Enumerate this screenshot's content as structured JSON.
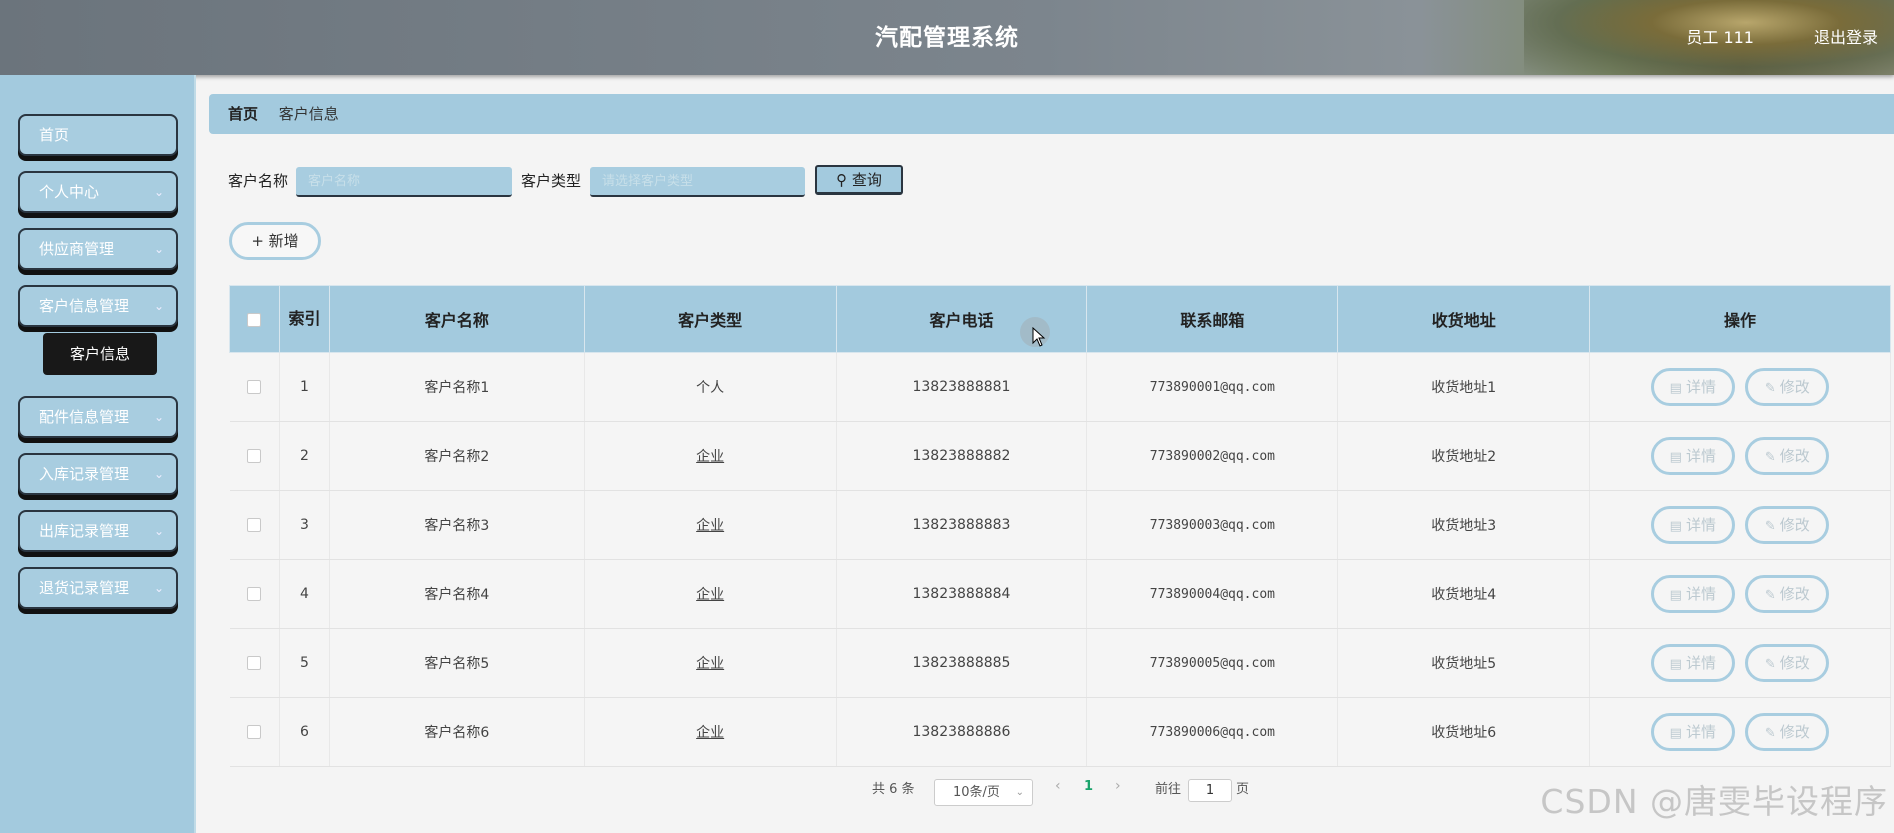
{
  "header": {
    "title": "汽配管理系统",
    "user": "员工  111",
    "logout": "退出登录"
  },
  "sidebar": {
    "items": [
      {
        "label": "首页",
        "has_chevron": false
      },
      {
        "label": "个人中心",
        "has_chevron": true
      },
      {
        "label": "供应商管理",
        "has_chevron": true
      },
      {
        "label": "客户信息管理",
        "has_chevron": true
      },
      {
        "label": "配件信息管理",
        "has_chevron": true
      },
      {
        "label": "入库记录管理",
        "has_chevron": true
      },
      {
        "label": "出库记录管理",
        "has_chevron": true
      },
      {
        "label": "退货记录管理",
        "has_chevron": true
      }
    ],
    "active_sub": "客户信息"
  },
  "breadcrumb": {
    "home": "首页",
    "current": "客户信息"
  },
  "search": {
    "name_label": "客户名称",
    "name_placeholder": "客户名称",
    "type_label": "客户类型",
    "type_placeholder": "请选择客户类型",
    "button": "查询"
  },
  "add_button": "新增",
  "table": {
    "headers": [
      "索引",
      "客户名称",
      "客户类型",
      "客户电话",
      "联系邮箱",
      "收货地址",
      "操作"
    ],
    "rows": [
      {
        "index": "1",
        "name": "客户名称1",
        "type": "个人",
        "phone": "13823888881",
        "email": "773890001@qq.com",
        "address": "收货地址1"
      },
      {
        "index": "2",
        "name": "客户名称2",
        "type": "企业",
        "phone": "13823888882",
        "email": "773890002@qq.com",
        "address": "收货地址2"
      },
      {
        "index": "3",
        "name": "客户名称3",
        "type": "企业",
        "phone": "13823888883",
        "email": "773890003@qq.com",
        "address": "收货地址3"
      },
      {
        "index": "4",
        "name": "客户名称4",
        "type": "企业",
        "phone": "13823888884",
        "email": "773890004@qq.com",
        "address": "收货地址4"
      },
      {
        "index": "5",
        "name": "客户名称5",
        "type": "企业",
        "phone": "13823888885",
        "email": "773890005@qq.com",
        "address": "收货地址5"
      },
      {
        "index": "6",
        "name": "客户名称6",
        "type": "企业",
        "phone": "13823888886",
        "email": "773890006@qq.com",
        "address": "收货地址6"
      }
    ],
    "detail_label": "详情",
    "edit_label": "修改"
  },
  "pagination": {
    "total": "共 6 条",
    "page_size": "10条/页",
    "current_page": "1",
    "goto_label": "前往",
    "goto_value": "1",
    "page_suffix": "页"
  },
  "watermark": "CSDN @唐雯毕设程序",
  "colors": {
    "accent": "#a3cade",
    "dark": "#181818",
    "page_active": "#1aa36b"
  }
}
